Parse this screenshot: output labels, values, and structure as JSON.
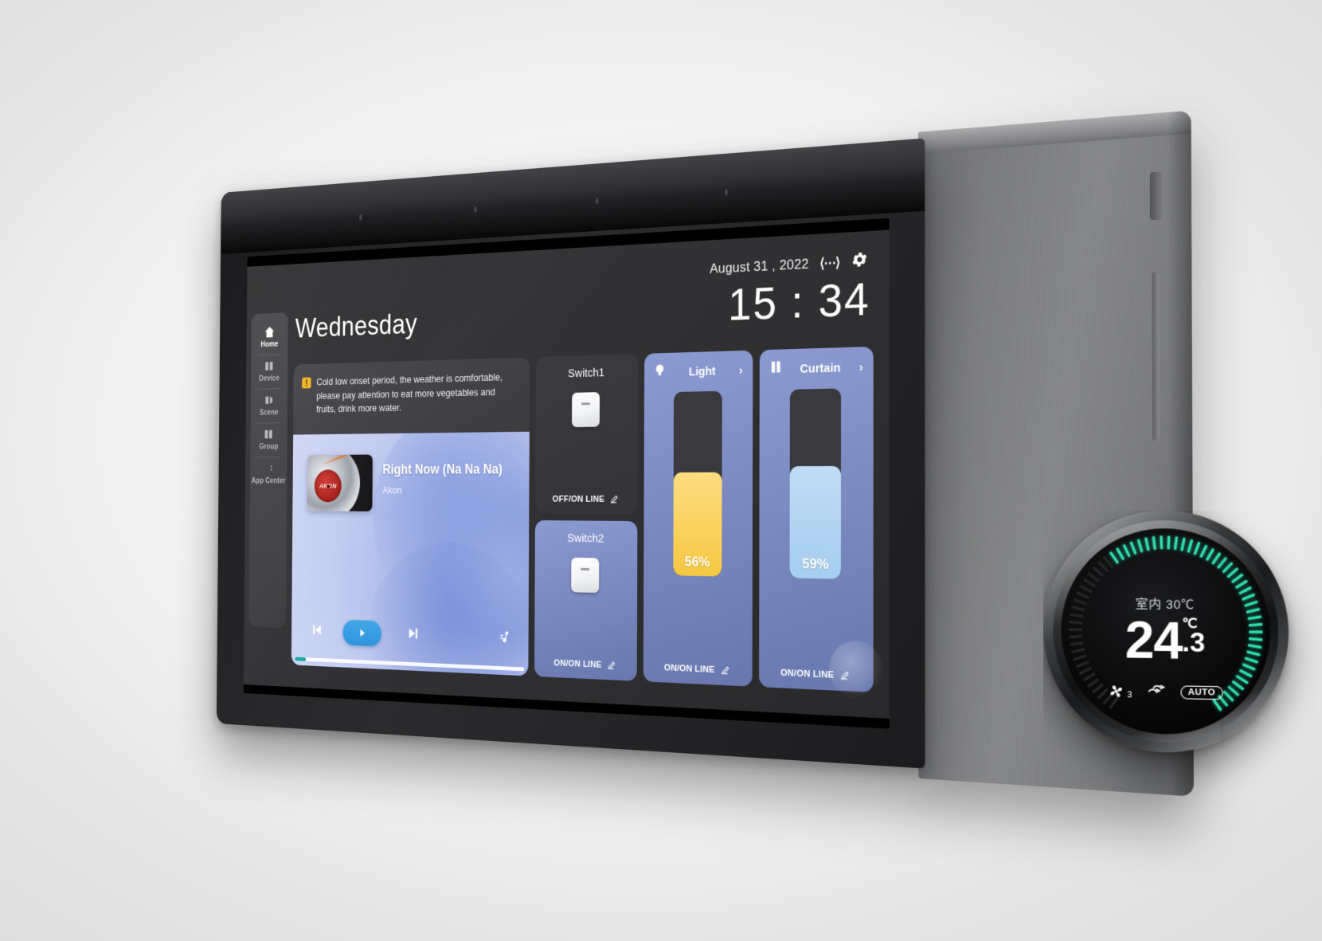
{
  "header": {
    "date": "August 31 , 2022",
    "net_icon": "network-icon",
    "settings_icon": "gear-icon",
    "clock": "15 : 34",
    "day": "Wednesday"
  },
  "sidebar": {
    "items": [
      {
        "label": "Home",
        "icon": "home-icon",
        "active": true
      },
      {
        "label": "Device",
        "icon": "device-icon",
        "active": false
      },
      {
        "label": "Scene",
        "icon": "scene-icon",
        "active": false
      },
      {
        "label": "Group",
        "icon": "group-icon",
        "active": false
      },
      {
        "label": "App Center",
        "icon": "app-center-icon",
        "active": false
      }
    ]
  },
  "weather_notice": {
    "icon": "warning-icon",
    "text": "Cold low onset period, the weather is comfortable, please pay attention to eat more vegetables and fruits, drink more water."
  },
  "music": {
    "album_label": "AKON",
    "title": "Right Now (Na Na Na)",
    "artist": "Akon",
    "prev_icon": "skip-previous-icon",
    "play_icon": "play-icon",
    "next_icon": "skip-next-icon",
    "eq_icon": "music-note-icon",
    "progress_percent": 5
  },
  "switches": [
    {
      "name": "Switch1",
      "status": "OFF/ON LINE",
      "state": "off",
      "edit_icon": "pencil-icon"
    },
    {
      "name": "Switch2",
      "status": "ON/ON LINE",
      "state": "on",
      "edit_icon": "pencil-icon"
    }
  ],
  "sliders": [
    {
      "name": "Light",
      "icon": "bulb-icon",
      "chevron": "›",
      "percent_label": "56%",
      "percent": 56,
      "status": "ON/ON LINE",
      "edit_icon": "pencil-icon",
      "fill_color": "#f5c842"
    },
    {
      "name": "Curtain",
      "icon": "curtain-icon",
      "chevron": "›",
      "percent_label": "59%",
      "percent": 59,
      "status": "ON/ON LINE",
      "edit_icon": "pencil-icon",
      "fill_color": "#a6cdef"
    }
  ],
  "thermostat": {
    "indoor_label": "室内 30℃",
    "temp_integer": "24",
    "temp_decimal": ".3",
    "temp_unit": "℃",
    "fan_icon": "fan-icon",
    "fan_speed": "3",
    "swing_icon": "airflow-icon",
    "mode_badge": "AUTO",
    "dial_color": "#2fe0b0",
    "dial_percent": 62
  },
  "colors": {
    "accent_blue": "#6878ae",
    "light_amber": "#f5c842",
    "curtain_blue": "#a6cdef",
    "dial_green": "#2fe0b0"
  }
}
